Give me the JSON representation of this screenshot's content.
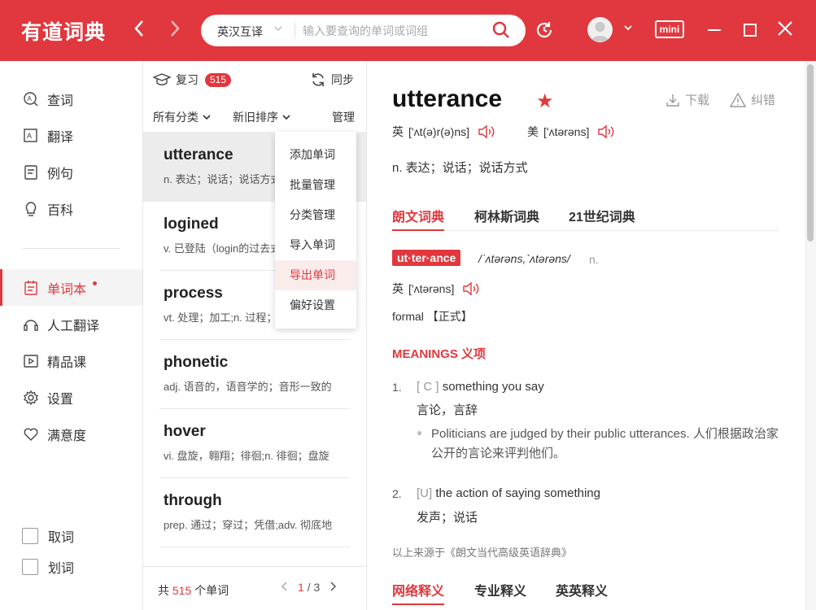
{
  "app": {
    "logo": "有道词典"
  },
  "search": {
    "mode": "英汉互译",
    "placeholder": "输入要查询的单词或词组",
    "value": ""
  },
  "window": {
    "mini_label": "mini"
  },
  "sidebar": {
    "items": [
      {
        "label": "查词",
        "icon": "search-word-icon"
      },
      {
        "label": "翻译",
        "icon": "translate-icon"
      },
      {
        "label": "例句",
        "icon": "example-icon"
      },
      {
        "label": "百科",
        "icon": "encyclopedia-icon"
      },
      {
        "label": "单词本",
        "icon": "wordbook-icon"
      },
      {
        "label": "人工翻译",
        "icon": "human-translate-icon"
      },
      {
        "label": "精品课",
        "icon": "course-icon"
      },
      {
        "label": "设置",
        "icon": "settings-icon"
      },
      {
        "label": "满意度",
        "icon": "heart-icon"
      }
    ],
    "checks": [
      {
        "label": "取词"
      },
      {
        "label": "划词"
      }
    ]
  },
  "wordlist": {
    "review_label": "复习",
    "review_count": "515",
    "sync_label": "同步",
    "filter_category": "所有分类",
    "filter_sort": "新旧排序",
    "manage_label": "管理",
    "words": [
      {
        "word": "utterance",
        "def": "n. 表达；说话；说话方式"
      },
      {
        "word": "logined",
        "def": "v. 已登陆（login的过去式）"
      },
      {
        "word": "process",
        "def": "vt. 处理；加工;n. 过程；工序"
      },
      {
        "word": "phonetic",
        "def": "adj. 语音的，语音学的；音形一致的"
      },
      {
        "word": "hover",
        "def": "vi. 盘旋，翱翔；徘徊;n. 徘徊；盘旋"
      },
      {
        "word": "through",
        "def": "prep. 通过；穿过；凭借;adv. 彻底地"
      }
    ],
    "footer": {
      "prefix": "共",
      "total": "515",
      "suffix": "个单词",
      "page": "1",
      "sep": "/",
      "pages": "3"
    }
  },
  "menu": {
    "items": [
      "添加单词",
      "批量管理",
      "分类管理",
      "导入单词",
      "导出单词",
      "偏好设置"
    ],
    "highlighted": "导出单词"
  },
  "entry": {
    "headword": "utterance",
    "download_label": "下载",
    "report_label": "纠错",
    "uk_label": "英",
    "uk_phonetic": "['ʌt(ə)r(ə)ns]",
    "us_label": "美",
    "us_phonetic": "['ʌtərəns]",
    "definition": "n. 表达；说话；说话方式",
    "dict_tabs": [
      "朗文词典",
      "柯林斯词典",
      "21世纪词典"
    ],
    "active_dict_tab": "朗文词典",
    "syllables": "ut·ter·ance",
    "ldoce_phonetic": "/ˈʌtərəns,ˋʌtərəns/",
    "ldoce_pos": "n.",
    "ldoce_uk_label": "英",
    "ldoce_uk_phonetic": "['ʌtərəns]",
    "register": "formal 【正式】",
    "meanings_heading": "MEANINGS 义项",
    "senses": [
      {
        "num": "1.",
        "gram": "[ C ]",
        "en": "something you say",
        "cn": "言论，言辞",
        "example": "Politicians are judged by their public utterances. 人们根据政治家公开的言论来评判他们。"
      },
      {
        "num": "2.",
        "gram": "[U]",
        "en": "the action of saying something",
        "cn": "发声；说话"
      }
    ],
    "source": "以上来源于《朗文当代高级英语辞典》",
    "bottom_tabs": [
      "网络释义",
      "专业释义",
      "英英释义"
    ],
    "active_bottom_tab": "网络释义"
  },
  "colors": {
    "brand": "#e0383e",
    "selected_row": "#ececec"
  }
}
